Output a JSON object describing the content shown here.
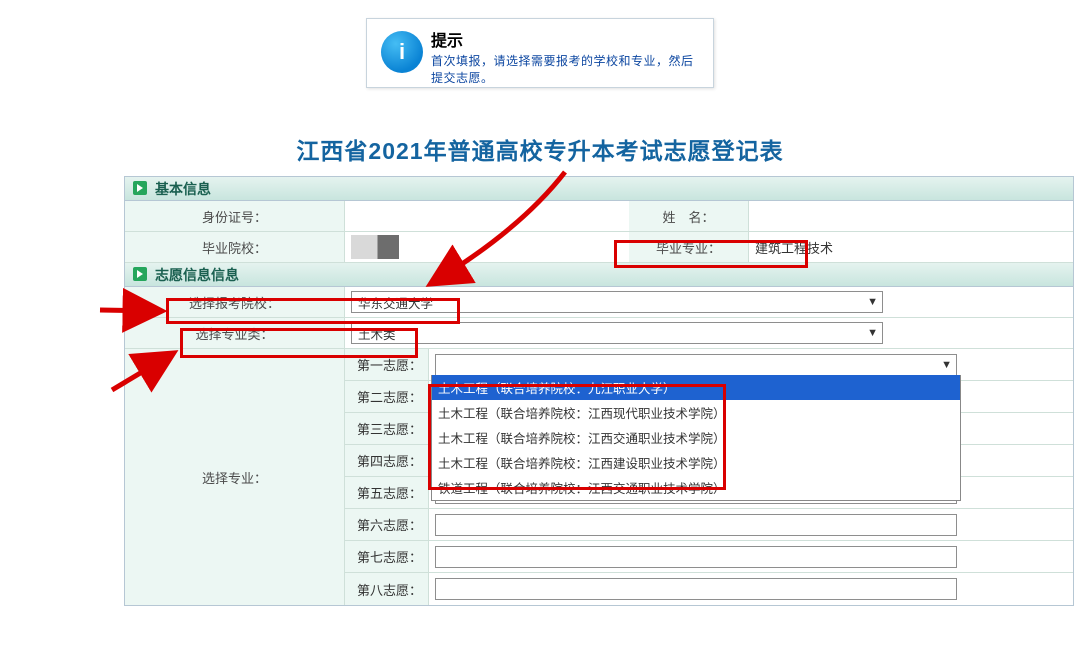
{
  "info": {
    "header": "提示",
    "message": "首次填报，请选择需要报考的学校和专业，然后提交志愿。"
  },
  "title": "江西省2021年普通高校专升本考试志愿登记表",
  "sections": {
    "basic": "基本信息",
    "vol": "志愿信息信息"
  },
  "basic": {
    "id_label": "身份证号：",
    "id_value": "",
    "name_label": "姓　名：",
    "name_value": "",
    "school_label": "毕业院校：",
    "school_value": "",
    "major_label": "毕业专业：",
    "major_value": "建筑工程技术"
  },
  "vol": {
    "select_school_label": "选择报考院校：",
    "select_school_value": "华东交通大学",
    "select_cat_label": "选择专业类：",
    "select_cat_value": "土木类",
    "specialty_rail": "选择专业：",
    "choices": {
      "c1": "第一志愿：",
      "c2": "第二志愿：",
      "c3": "第三志愿：",
      "c4": "第四志愿：",
      "c5": "第五志愿：",
      "c6": "第六志愿：",
      "c7": "第七志愿：",
      "c8": "第八志愿："
    },
    "dropdown": {
      "o1": "土木工程（联合培养院校：九江职业大学）",
      "o2": "土木工程（联合培养院校：江西现代职业技术学院）",
      "o3": "土木工程（联合培养院校：江西交通职业技术学院）",
      "o4": "土木工程（联合培养院校：江西建设职业技术学院）",
      "o5": "铁道工程（联合培养院校：江西交通职业技术学院）"
    }
  }
}
